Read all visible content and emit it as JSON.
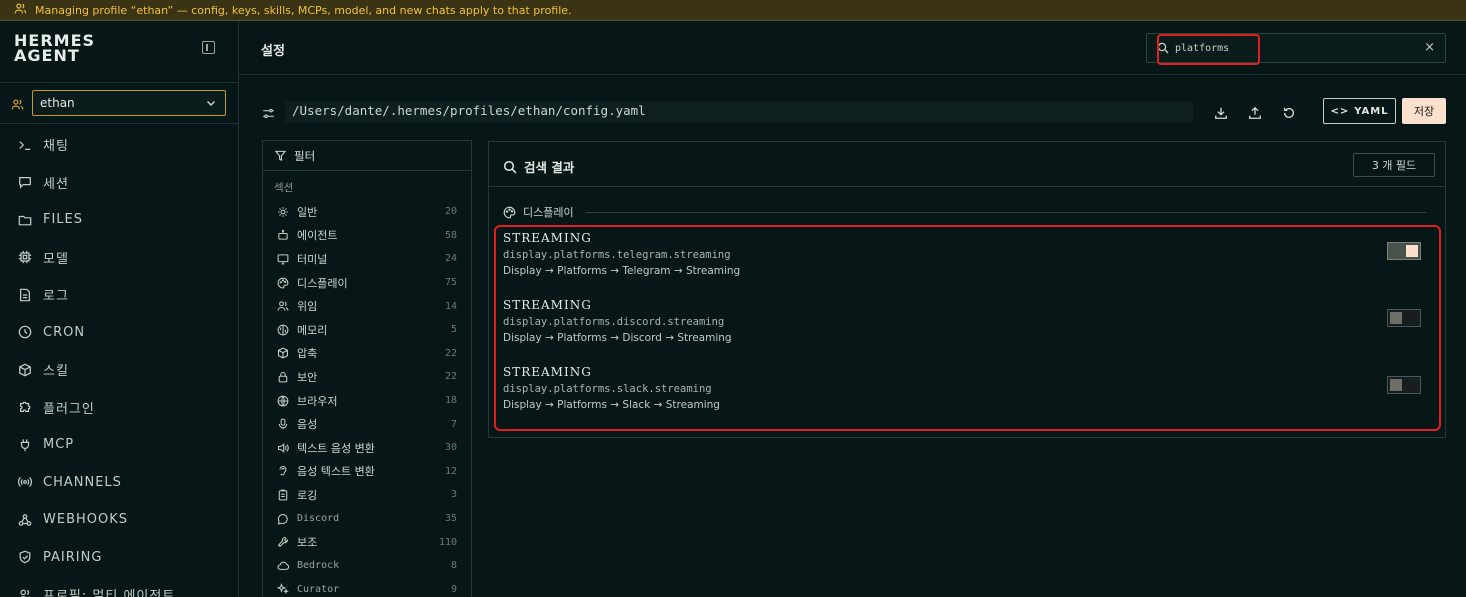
{
  "banner": {
    "text": "Managing profile “ethan” — config, keys, skills, MCPs, model, and new chats apply to that profile."
  },
  "app": {
    "brand_line1": "HERMES",
    "brand_line2": "AGENT"
  },
  "profile": {
    "selected": "ethan"
  },
  "nav": {
    "items": [
      {
        "label": "채팅",
        "icon": "terminal-icon"
      },
      {
        "label": "세션",
        "icon": "chat-bubble-icon"
      },
      {
        "label": "FILES",
        "icon": "folder-icon"
      },
      {
        "label": "모델",
        "icon": "cpu-icon"
      },
      {
        "label": "로그",
        "icon": "document-icon"
      },
      {
        "label": "CRON",
        "icon": "clock-icon"
      },
      {
        "label": "스킬",
        "icon": "cube-icon"
      },
      {
        "label": "플러그인",
        "icon": "puzzle-icon"
      },
      {
        "label": "MCP",
        "icon": "plug-icon"
      },
      {
        "label": "CHANNELS",
        "icon": "broadcast-icon"
      },
      {
        "label": "WEBHOOKS",
        "icon": "webhook-icon"
      },
      {
        "label": "PAIRING",
        "icon": "shield-check-icon"
      },
      {
        "label": "프로필: 멀티 에이전트",
        "icon": "users-icon"
      }
    ]
  },
  "header": {
    "title": "설정"
  },
  "search": {
    "value": "platforms",
    "clear_label": "×"
  },
  "config": {
    "path": "/Users/dante/.hermes/profiles/ethan/config.yaml",
    "yaml_label": "YAML",
    "save_label": "저장"
  },
  "filter": {
    "title": "필터",
    "section_label": "섹션",
    "items": [
      {
        "label": "일반",
        "count": "20",
        "icon": "gear-icon"
      },
      {
        "label": "에이전트",
        "count": "58",
        "icon": "robot-icon"
      },
      {
        "label": "터미널",
        "count": "24",
        "icon": "monitor-icon"
      },
      {
        "label": "디스플레이",
        "count": "75",
        "icon": "palette-icon"
      },
      {
        "label": "위임",
        "count": "14",
        "icon": "users-icon"
      },
      {
        "label": "메모리",
        "count": "5",
        "icon": "brain-icon"
      },
      {
        "label": "압축",
        "count": "22",
        "icon": "package-icon"
      },
      {
        "label": "보안",
        "count": "22",
        "icon": "lock-icon"
      },
      {
        "label": "브라우저",
        "count": "18",
        "icon": "globe-icon"
      },
      {
        "label": "음성",
        "count": "7",
        "icon": "microphone-icon"
      },
      {
        "label": "텍스트 음성 변환",
        "count": "30",
        "icon": "speaker-icon"
      },
      {
        "label": "음성 텍스트 변환",
        "count": "12",
        "icon": "ear-icon"
      },
      {
        "label": "로깅",
        "count": "3",
        "icon": "clipboard-icon"
      },
      {
        "label": "Discord",
        "count": "35",
        "icon": "message-circle-icon"
      },
      {
        "label": "보조",
        "count": "110",
        "icon": "wrench-icon"
      },
      {
        "label": "Bedrock",
        "count": "8",
        "icon": "cloud-icon"
      },
      {
        "label": "Curator",
        "count": "9",
        "icon": "sparkle-icon"
      }
    ]
  },
  "results": {
    "title": "검색 결과",
    "count_label": "3 개 필드",
    "group_label": "디스플레이",
    "rows": [
      {
        "title": "STREAMING",
        "key": "display.platforms.telegram.streaming",
        "path": "Display → Platforms → Telegram → Streaming",
        "enabled": true
      },
      {
        "title": "STREAMING",
        "key": "display.platforms.discord.streaming",
        "path": "Display → Platforms → Discord → Streaming",
        "enabled": false
      },
      {
        "title": "STREAMING",
        "key": "display.platforms.slack.streaming",
        "path": "Display → Platforms → Slack → Streaming",
        "enabled": false
      }
    ]
  },
  "colors": {
    "background": "#071718",
    "accent_gold": "#e0a830",
    "banner_text": "#f0c040",
    "save_bg": "#fbe0cc",
    "highlight": "#e0201c"
  }
}
